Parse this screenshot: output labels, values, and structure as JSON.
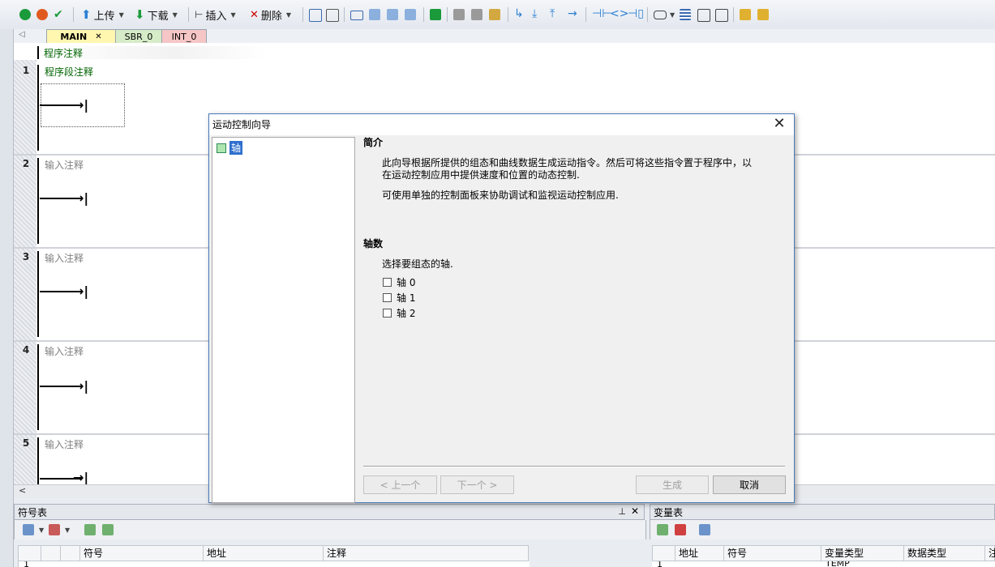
{
  "toolbar": {
    "upload_label": "上传",
    "download_label": "下载",
    "insert_label": "插入",
    "delete_label": "删除"
  },
  "tabs": [
    {
      "label": "MAIN",
      "close": "✕"
    },
    {
      "label": "SBR_0"
    },
    {
      "label": "INT_0"
    }
  ],
  "editor": {
    "program_comment": "程序注释",
    "networks": [
      {
        "num": "1",
        "comment": "程序段注释"
      },
      {
        "num": "2",
        "comment": "输入注释"
      },
      {
        "num": "3",
        "comment": "输入注释"
      },
      {
        "num": "4",
        "comment": "输入注释"
      },
      {
        "num": "5",
        "comment": "输入注释"
      }
    ]
  },
  "symbol_table": {
    "title": "符号表",
    "columns": [
      "符号",
      "地址",
      "注释"
    ],
    "row_num": "1"
  },
  "var_table": {
    "title": "变量表",
    "columns": [
      "地址",
      "符号",
      "变量类型",
      "数据类型",
      "注"
    ],
    "row_num": "1",
    "first_var_type": "TEMP"
  },
  "dialog": {
    "title": "运动控制向导",
    "close_glyph": "✕",
    "tree_item": "轴",
    "intro_heading": "简介",
    "intro_line1": "此向导根据所提供的组态和曲线数据生成运动指令。然后可将这些指令置于程序中，以",
    "intro_line2": "在运动控制应用中提供速度和位置的动态控制.",
    "intro_line3": "可使用单独的控制面板来协助调试和监视运动控制应用.",
    "axes_heading": "轴数",
    "axes_prompt": "选择要组态的轴.",
    "axes": [
      {
        "label": "轴 0",
        "checked": false
      },
      {
        "label": "轴 1",
        "checked": false
      },
      {
        "label": "轴 2",
        "checked": false
      }
    ],
    "buttons": {
      "prev": "< 上一个",
      "next": "下一个 >",
      "generate": "生成",
      "cancel": "取消"
    }
  },
  "colors": {
    "comment_green": "#006400",
    "comment_gray": "#808080",
    "tab_main": "#fff6b0",
    "tab_sbr": "#d6ecc8",
    "tab_int": "#f6c6c6",
    "dialog_border": "#4a7ab8",
    "tree_select": "#cce4f7"
  }
}
